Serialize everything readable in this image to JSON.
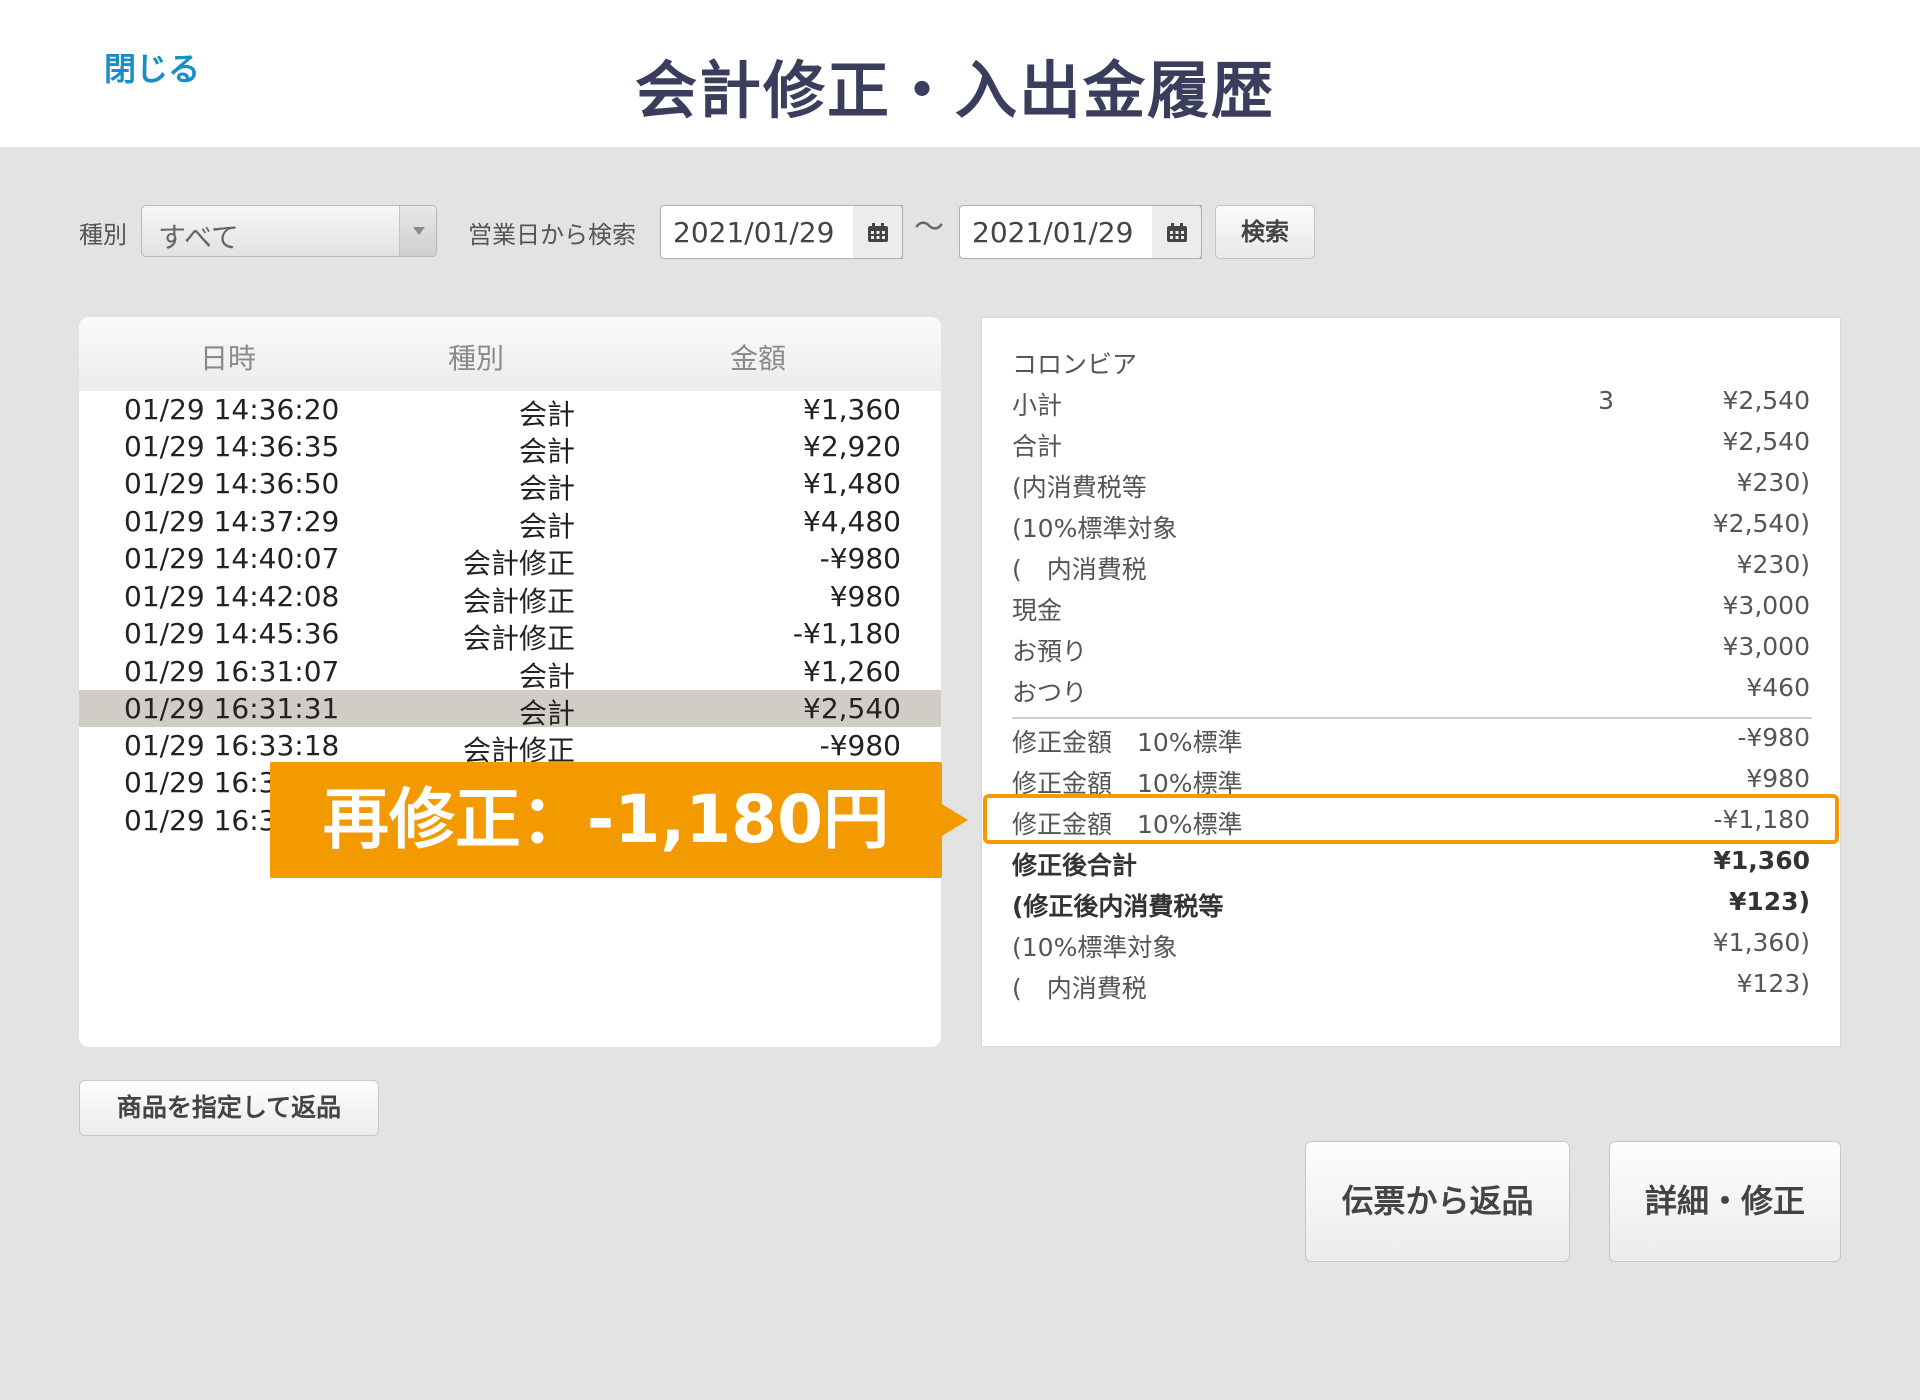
{
  "header": {
    "close_label": "閉じる",
    "title": "会計修正・入出金履歴"
  },
  "filter": {
    "type_label": "種別",
    "type_value": "すべて",
    "date_label": "営業日から検索",
    "date_from": "2021/01/29",
    "separator": "〜",
    "date_to": "2021/01/29",
    "search_label": "検索"
  },
  "list": {
    "headers": [
      "日時",
      "種別",
      "金額"
    ],
    "rows": [
      {
        "date": "01/29 14:36:20",
        "type": "会計",
        "amount": "¥1,360"
      },
      {
        "date": "01/29 14:36:35",
        "type": "会計",
        "amount": "¥2,920"
      },
      {
        "date": "01/29 14:36:50",
        "type": "会計",
        "amount": "¥1,480"
      },
      {
        "date": "01/29 14:37:29",
        "type": "会計",
        "amount": "¥4,480"
      },
      {
        "date": "01/29 14:40:07",
        "type": "会計修正",
        "amount": "-¥980"
      },
      {
        "date": "01/29 14:42:08",
        "type": "会計修正",
        "amount": "¥980"
      },
      {
        "date": "01/29 14:45:36",
        "type": "会計修正",
        "amount": "-¥1,180"
      },
      {
        "date": "01/29 16:31:07",
        "type": "会計",
        "amount": "¥1,260"
      },
      {
        "date": "01/29 16:31:31",
        "type": "会計",
        "amount": "¥2,540"
      },
      {
        "date": "01/29 16:33:18",
        "type": "会計修正",
        "amount": "-¥980"
      },
      {
        "date": "01/29 16:3",
        "type": "",
        "amount": ""
      },
      {
        "date": "01/29 16:3",
        "type": "",
        "amount": ""
      }
    ]
  },
  "detail": {
    "item_name": "コロンビア",
    "rows": [
      {
        "label": "小計",
        "qty": "3",
        "value": "¥2,540"
      },
      {
        "label": "合計",
        "value": "¥2,540"
      },
      {
        "label": "(内消費税等",
        "value": "¥230)"
      },
      {
        "label": "(10%標準対象",
        "value": "¥2,540)"
      },
      {
        "label": "(　内消費税",
        "value": "¥230)"
      },
      {
        "label": "現金",
        "value": "¥3,000"
      },
      {
        "label": "お預り",
        "value": "¥3,000"
      },
      {
        "label": "おつり",
        "value": "¥460"
      },
      {
        "label": "修正金額　10%標準",
        "value": "-¥980"
      },
      {
        "label": "修正金額　10%標準",
        "value": "¥980"
      },
      {
        "label": "修正金額　10%標準",
        "value": "-¥1,180"
      },
      {
        "label": "修正後合計",
        "value": "¥1,360"
      },
      {
        "label": "(修正後内消費税等",
        "value": "¥123)"
      },
      {
        "label": "(10%標準対象",
        "value": "¥1,360)"
      },
      {
        "label": "(　内消費税",
        "value": "¥123)"
      }
    ]
  },
  "callout": {
    "text": "再修正：-1,180円"
  },
  "buttons": {
    "return_product": "商品を指定して返品",
    "slip_return": "伝票から返品",
    "detail_edit": "詳細・修正"
  },
  "colors": {
    "accent": "#f39a00",
    "link": "#1a8ec4",
    "title": "#3a3d5c"
  }
}
